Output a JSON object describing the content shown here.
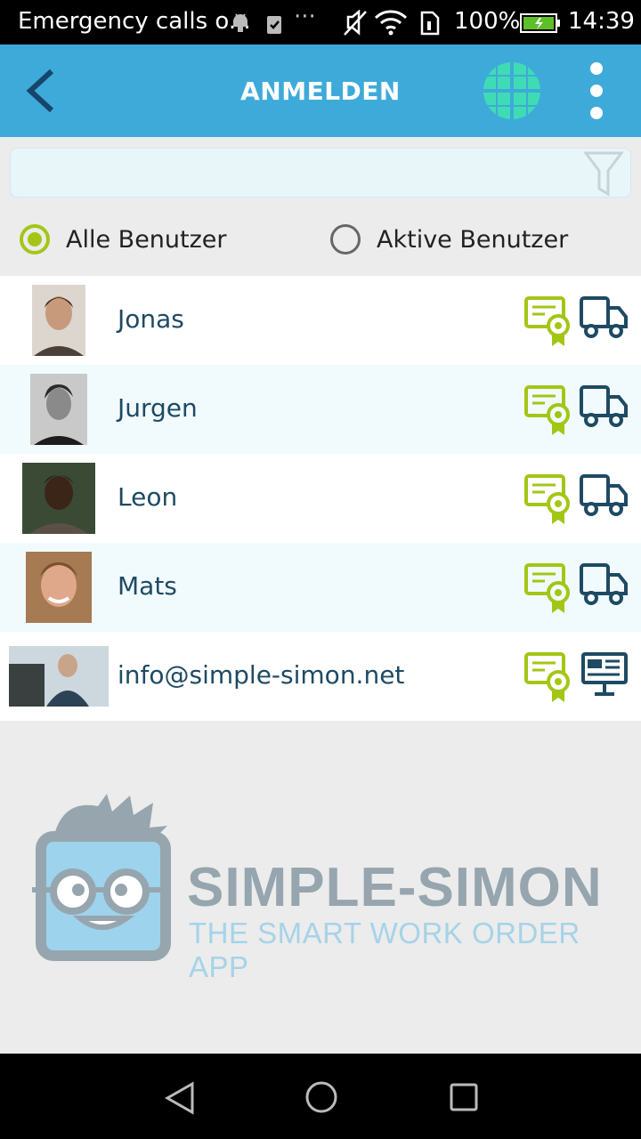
{
  "status_bar": {
    "notification_text": "Emergency calls o...",
    "battery": "100%",
    "time": "14:39"
  },
  "app_bar": {
    "title": "ANMELDEN",
    "back_icon": "chevron-left-icon",
    "grid_icon": "globe-grid-icon",
    "menu_icon": "more-vertical-icon"
  },
  "filter": {
    "search_value": "",
    "filter_icon": "filter-icon",
    "options": [
      {
        "label": "Alle Benutzer",
        "selected": true
      },
      {
        "label": "Aktive Benutzer",
        "selected": false
      }
    ]
  },
  "users": [
    {
      "name": "Jonas",
      "icons": [
        "certificate-icon",
        "truck-icon"
      ]
    },
    {
      "name": "Jurgen",
      "icons": [
        "certificate-icon",
        "truck-icon"
      ]
    },
    {
      "name": "Leon",
      "icons": [
        "certificate-icon",
        "truck-icon"
      ]
    },
    {
      "name": "Mats",
      "icons": [
        "certificate-icon",
        "truck-icon"
      ]
    },
    {
      "name": "info@simple-simon.net",
      "icons": [
        "certificate-icon",
        "monitor-icon"
      ]
    }
  ],
  "brand": {
    "name": "SIMPLE-SIMON",
    "tagline": "THE SMART WORK ORDER APP"
  },
  "colors": {
    "appbar": "#3eaad9",
    "accent_green": "#a3c615",
    "dark_blue": "#1e4a63",
    "teal": "#3fdcb4"
  }
}
